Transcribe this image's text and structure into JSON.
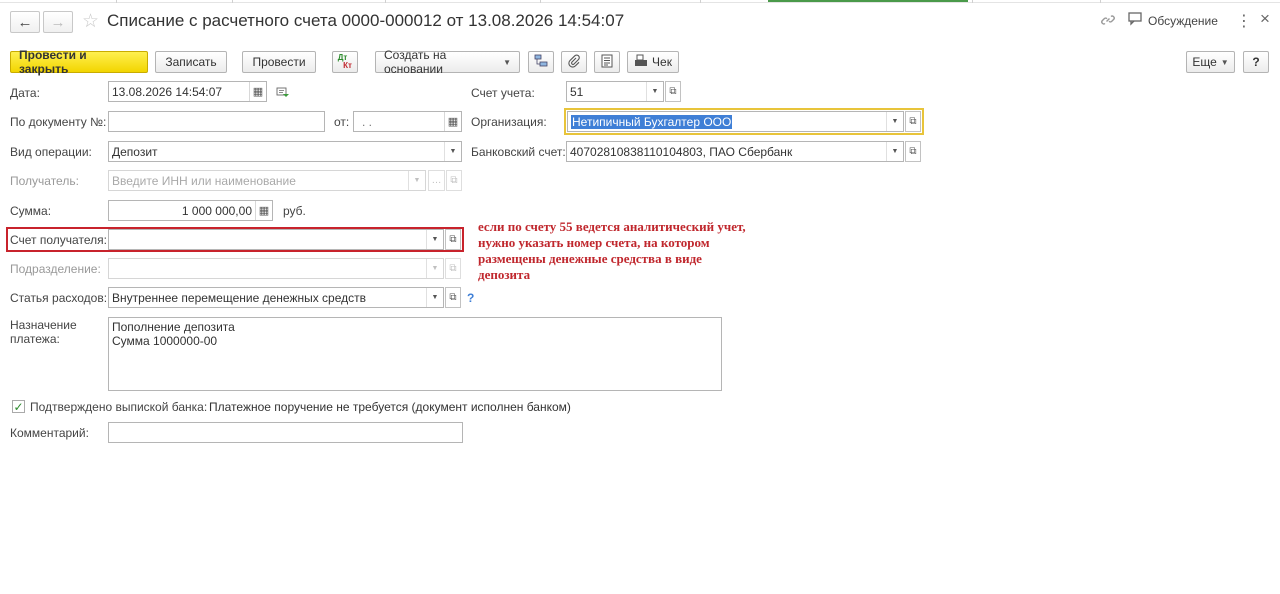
{
  "header": {
    "title": "Списание с расчетного счета 0000-000012 от 13.08.2026 14:54:07",
    "back_icon": "arrow-left-icon",
    "forward_icon": "arrow-right-icon",
    "favorite_icon": "star-icon",
    "link_icon": "link-icon",
    "discussion_label": "Обсуждение",
    "more_icon": "kebab-icon",
    "close_icon": "close-icon"
  },
  "toolbar": {
    "post_close": "Провести и закрыть",
    "save": "Записать",
    "post": "Провести",
    "dt_kt_top": "Дт",
    "dt_kt_bottom": "Кт",
    "create_based": "Создать на основании",
    "check": "Чек",
    "more": "Еще",
    "help": "?"
  },
  "form": {
    "date_label": "Дата:",
    "date_value": "13.08.2026 14:54:07",
    "doc_num_label": "По документу №:",
    "doc_num_value": "",
    "from_label": "от:",
    "from_value": " .  .",
    "op_type_label": "Вид операции:",
    "op_type_value": "Депозит",
    "recipient_label": "Получатель:",
    "recipient_placeholder": "Введите ИНН или наименование",
    "sum_label": "Сумма:",
    "sum_value": "1 000 000,00",
    "currency": "руб.",
    "recipient_account_label": "Счет получателя:",
    "recipient_account_value": "",
    "division_label": "Подразделение:",
    "division_value": "",
    "expense_label": "Статья расходов:",
    "expense_value": "Внутреннее перемещение денежных средств",
    "purpose_label_1": "Назначение",
    "purpose_label_2": "платежа:",
    "purpose_line_1": "Пополнение депозита",
    "purpose_line_2": "Сумма 1000000-00",
    "confirmed_label": "Подтверждено выпиской банка:",
    "confirmed_checked": true,
    "payment_order_text": "Платежное поручение не требуется (документ исполнен банком)",
    "comment_label": "Комментарий:",
    "comment_value": "",
    "account_label": "Счет учета:",
    "account_value": "51",
    "org_label": "Организация:",
    "org_value": "Нетипичный Бухгалтер ООО",
    "bank_account_label": "Банковский счет:",
    "bank_account_value": "40702810838110104803, ПАО Сбербанк"
  },
  "annotation": {
    "line_1": "если по счету 55 ведется аналитический учет,",
    "line_2": "нужно указать номер счета, на котором",
    "line_3": "размещены денежные средства в виде",
    "line_4": "депозита",
    "color": "#c0272d"
  },
  "colors": {
    "primary_button": "#f2d500",
    "focus_border": "#e8c43a",
    "highlight_border": "#c8232c",
    "selection": "#3f7fd6"
  }
}
